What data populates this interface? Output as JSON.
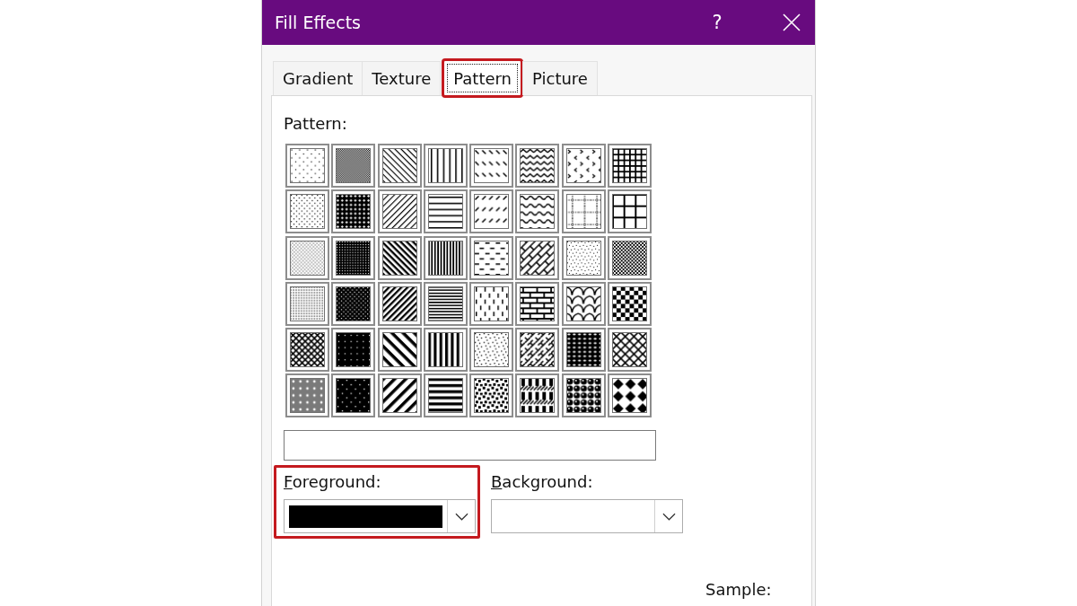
{
  "window": {
    "title": "Fill Effects",
    "help_button": "?"
  },
  "tabs": [
    {
      "label": "Gradient",
      "selected": false,
      "highlighted": false
    },
    {
      "label": "Texture",
      "selected": false,
      "highlighted": false
    },
    {
      "label": "Pattern",
      "selected": true,
      "highlighted": true
    },
    {
      "label": "Picture",
      "selected": false,
      "highlighted": false
    }
  ],
  "pattern_panel": {
    "label": "Pattern:",
    "patterns": [
      {
        "kind": "pct5",
        "selected": false
      },
      {
        "kind": "pct50",
        "selected": false
      },
      {
        "kind": "ltdndiag",
        "selected": false
      },
      {
        "kind": "ltvert",
        "selected": false
      },
      {
        "kind": "dashdndiag",
        "selected": false
      },
      {
        "kind": "zigzag",
        "selected": false
      },
      {
        "kind": "divot",
        "selected": false
      },
      {
        "kind": "smgrid",
        "selected": false
      },
      {
        "kind": "pct10",
        "selected": false
      },
      {
        "kind": "pct70",
        "selected": false
      },
      {
        "kind": "ltupdiag",
        "selected": false
      },
      {
        "kind": "lthorz",
        "selected": false
      },
      {
        "kind": "dashupdiag",
        "selected": false
      },
      {
        "kind": "wave",
        "selected": false
      },
      {
        "kind": "dotgrid",
        "selected": false
      },
      {
        "kind": "lggrid",
        "selected": false
      },
      {
        "kind": "pct20",
        "selected": false
      },
      {
        "kind": "pct75",
        "selected": false
      },
      {
        "kind": "dkdndiag",
        "selected": false
      },
      {
        "kind": "dkvert",
        "selected": false
      },
      {
        "kind": "dashhorz",
        "selected": false
      },
      {
        "kind": "diagbrick",
        "selected": false
      },
      {
        "kind": "smconfetti",
        "selected": false
      },
      {
        "kind": "smcheck",
        "selected": false
      },
      {
        "kind": "pct25",
        "selected": false
      },
      {
        "kind": "pct80",
        "selected": false
      },
      {
        "kind": "dkupdiag",
        "selected": false
      },
      {
        "kind": "dkhorz",
        "selected": false
      },
      {
        "kind": "dashvert",
        "selected": false
      },
      {
        "kind": "horzbrick",
        "selected": false
      },
      {
        "kind": "shingle",
        "selected": false
      },
      {
        "kind": "lgcheck",
        "selected": false
      },
      {
        "kind": "lattice",
        "selected": false
      },
      {
        "kind": "pct90",
        "selected": false
      },
      {
        "kind": "wddndiag",
        "selected": false
      },
      {
        "kind": "wdvert",
        "selected": false
      },
      {
        "kind": "confetti",
        "selected": false
      },
      {
        "kind": "weave",
        "selected": false
      },
      {
        "kind": "trellis",
        "selected": false
      },
      {
        "kind": "diagcross",
        "selected": false
      },
      {
        "kind": "pct30",
        "selected": false
      },
      {
        "kind": "pct95",
        "selected": false
      },
      {
        "kind": "wdupdiag",
        "selected": false
      },
      {
        "kind": "wdhorz",
        "selected": false
      },
      {
        "kind": "lgconfetti",
        "selected": false
      },
      {
        "kind": "plaid",
        "selected": false
      },
      {
        "kind": "sphere",
        "selected": false
      },
      {
        "kind": "soliddiamond",
        "selected": false
      }
    ]
  },
  "color_pickers": [
    {
      "label": "Foreground:",
      "accelerator_first": true,
      "color": "#000000",
      "highlighted": true
    },
    {
      "label": "Background:",
      "accelerator_first": true,
      "highlighted": false
    }
  ],
  "sample": {
    "label": "Sample:"
  }
}
